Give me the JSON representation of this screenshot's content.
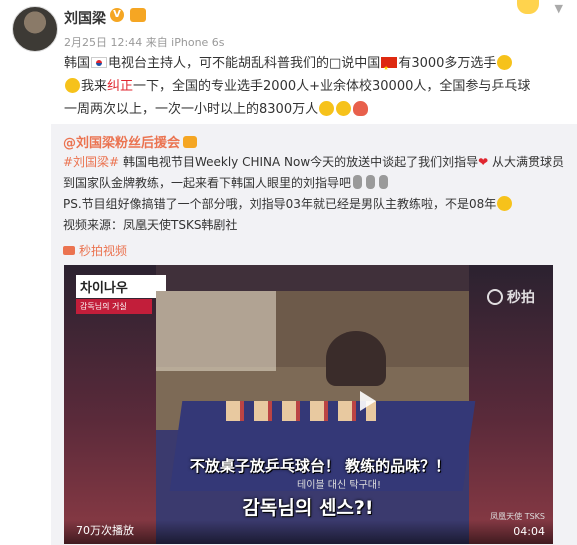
{
  "post": {
    "author": "刘国梁",
    "meta": "2月25日 12:44 来自 iPhone 6s",
    "line1_a": "韩国",
    "line1_b": "电视台主持人，可不能胡乱科普我们的□说中国",
    "line1_c": "有3000多万选手",
    "line2_a": "我来",
    "line2_hl": "纠正",
    "line2_b": "一下，全国的专业选手2000人+业余体校30000人，全国参与乒乓球",
    "line3": "一周两次以上，一次一小时以上的8300万人"
  },
  "repost": {
    "author": "@刘国梁粉丝后援会",
    "tag": "#刘国梁#",
    "l1": " 韩国电视节目Weekly CHINA Now今天的放送中谈起了我们刘指导",
    "l1b": " 从大满贯球员",
    "l2": "到国家队金牌教练，一起来看下韩国人眼里的刘指导吧",
    "l3_a": "PS.节目组好像搞错了一个部分哦，刘指导03年就已经是男队主教练啦，不是08年",
    "l4": "视频来源：凤凰天使TSKS韩剧社",
    "video_link": "秒拍视频"
  },
  "video": {
    "logo": "차이나우",
    "logo_sub": "감독님의 거실",
    "subtitle_cn": "不放桌子放乒乓球台！ 教练的品味？！",
    "subtitle_kr_small": "테이블 대신 탁구대!",
    "subtitle_kr": "감독님의 센스?!",
    "watermark": "秒拍",
    "brand": "凤凰天使 TSKS",
    "plays": "70万次播放",
    "duration": "04:04"
  },
  "icons": [
    "avatar",
    "verified-icon",
    "crown-icon",
    "chevron-down-icon",
    "play-icon"
  ],
  "colors": {
    "accent": "#eb7350",
    "highlight": "#e0262f"
  }
}
